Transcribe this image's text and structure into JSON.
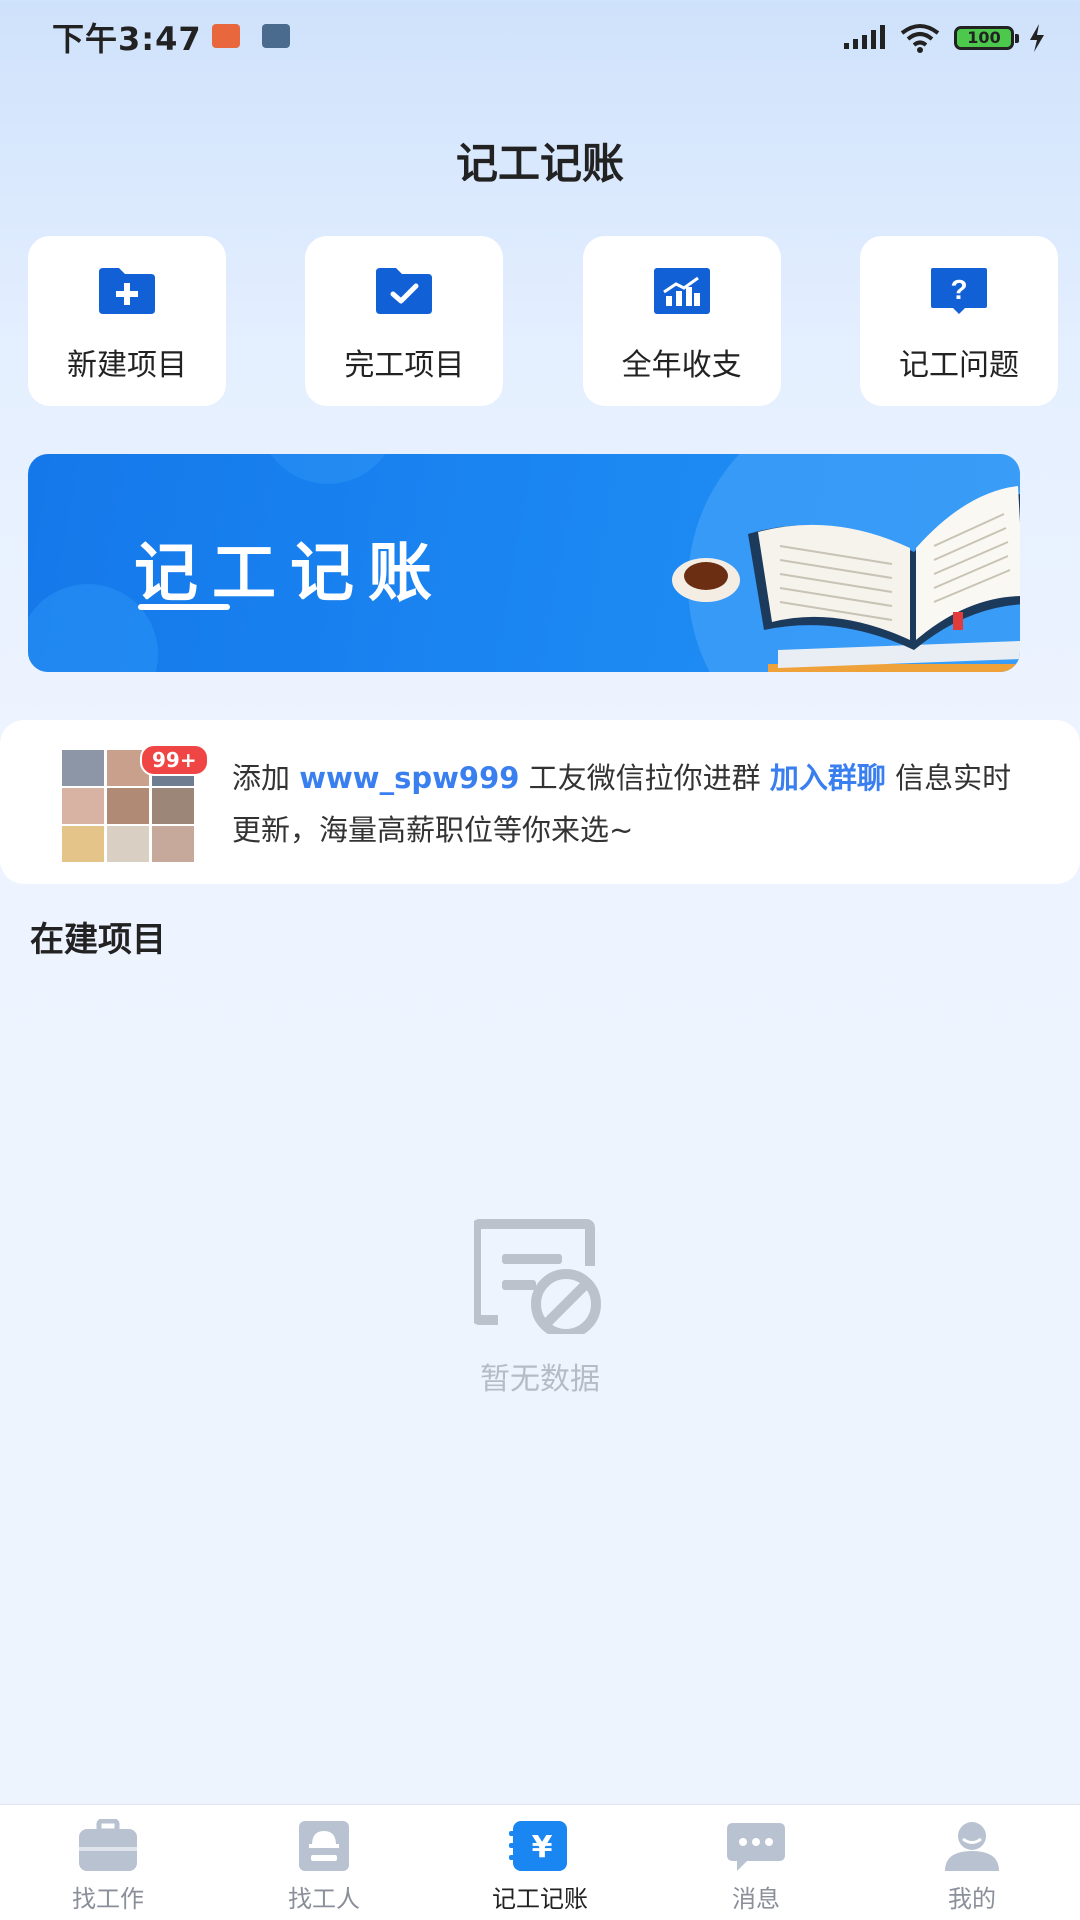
{
  "status_bar": {
    "time": "下午3:47",
    "battery": "100"
  },
  "header": {
    "title": "记工记账"
  },
  "quick_actions": [
    {
      "label": "新建项目",
      "icon": "folder-plus-icon"
    },
    {
      "label": "完工项目",
      "icon": "folder-check-icon"
    },
    {
      "label": "全年收支",
      "icon": "chart-icon"
    },
    {
      "label": "记工问题",
      "icon": "question-icon"
    }
  ],
  "banner": {
    "title": "记工记账"
  },
  "notice": {
    "badge": "99+",
    "prefix": "添加 ",
    "wechat_id": "www_spw999",
    "middle": " 工友微信拉你进群 ",
    "join_text": "加入群聊",
    "suffix": " 信息实时更新，海量高薪职位等你来选~"
  },
  "section": {
    "title": "在建项目"
  },
  "empty_state": {
    "text": "暂无数据"
  },
  "bottom_nav": {
    "items": [
      {
        "label": "找工作",
        "icon": "briefcase-icon"
      },
      {
        "label": "找工人",
        "icon": "worker-icon"
      },
      {
        "label": "记工记账",
        "icon": "yen-notebook-icon",
        "active": true
      },
      {
        "label": "消息",
        "icon": "message-icon"
      },
      {
        "label": "我的",
        "icon": "profile-icon"
      }
    ]
  },
  "colors": {
    "accent": "#1a86f2",
    "icon_blue": "#1260d6",
    "highlight": "#3a7ff0",
    "badge": "#f04545",
    "nav_inactive": "#b8c2d0"
  }
}
